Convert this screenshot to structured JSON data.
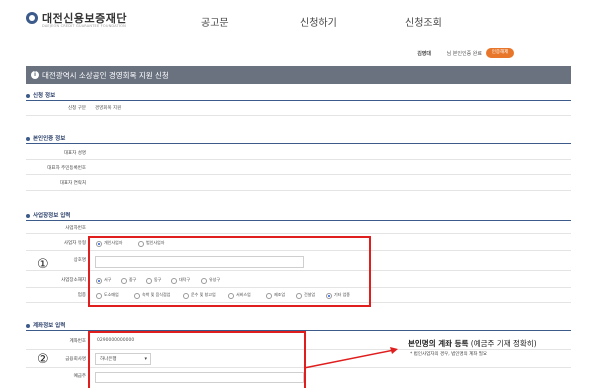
{
  "header": {
    "logo_name": "대전신용보증재단",
    "logo_sub": "DAEJEON CREDIT GUARANTEE FOUNDATION",
    "nav": [
      "공고문",
      "신청하기",
      "신청조회"
    ],
    "user_name": "김영대",
    "user_suffix": "님 본인인증 완료",
    "logout_label": "인증해제"
  },
  "page_title": "대전광역시 소상공인 경영회복 지원 신청",
  "sections": {
    "apply_info": {
      "title": "신청 정보",
      "label": "신청 구분",
      "value": "경영회복 지원"
    },
    "identity": {
      "title": "본인인증 정보",
      "labels": [
        "대표자 성명",
        "대표자 주민등록번호",
        "대표자 연락처"
      ]
    },
    "business": {
      "title": "사업장정보 입력",
      "labels": [
        "사업자번호",
        "사업자 유형",
        "상호명",
        "사업장소재지",
        "업종"
      ],
      "type_options": [
        "개인사업자",
        "법인사업자"
      ],
      "type_selected": 0,
      "district_options": [
        "서구",
        "중구",
        "동구",
        "대덕구",
        "유성구"
      ],
      "district_selected": 0,
      "industry_options": [
        "도소매업",
        "숙박 및 음식점업",
        "운수 및 창고업",
        "서비스업",
        "제조업",
        "건설업",
        "기타 업종"
      ],
      "industry_selected": 6,
      "marker": "①"
    },
    "account": {
      "title": "계좌정보 입력",
      "labels": [
        "계좌번호",
        "금융회사명",
        "예금주"
      ],
      "account_number": "0290000000000",
      "bank_selected": "하나은행",
      "marker": "②"
    }
  },
  "note": {
    "main_bold": "본인명의 계좌 등록",
    "main_rest": " (예금주 기재 정확히)",
    "sub": "* 법인사업자의 경우, 법인명의 계좌 필요"
  },
  "colors": {
    "titlebar": "#6a7280",
    "accent": "#3c5a8a",
    "highlight_box": "#e01e1e",
    "logout_button": "#e8762a"
  }
}
